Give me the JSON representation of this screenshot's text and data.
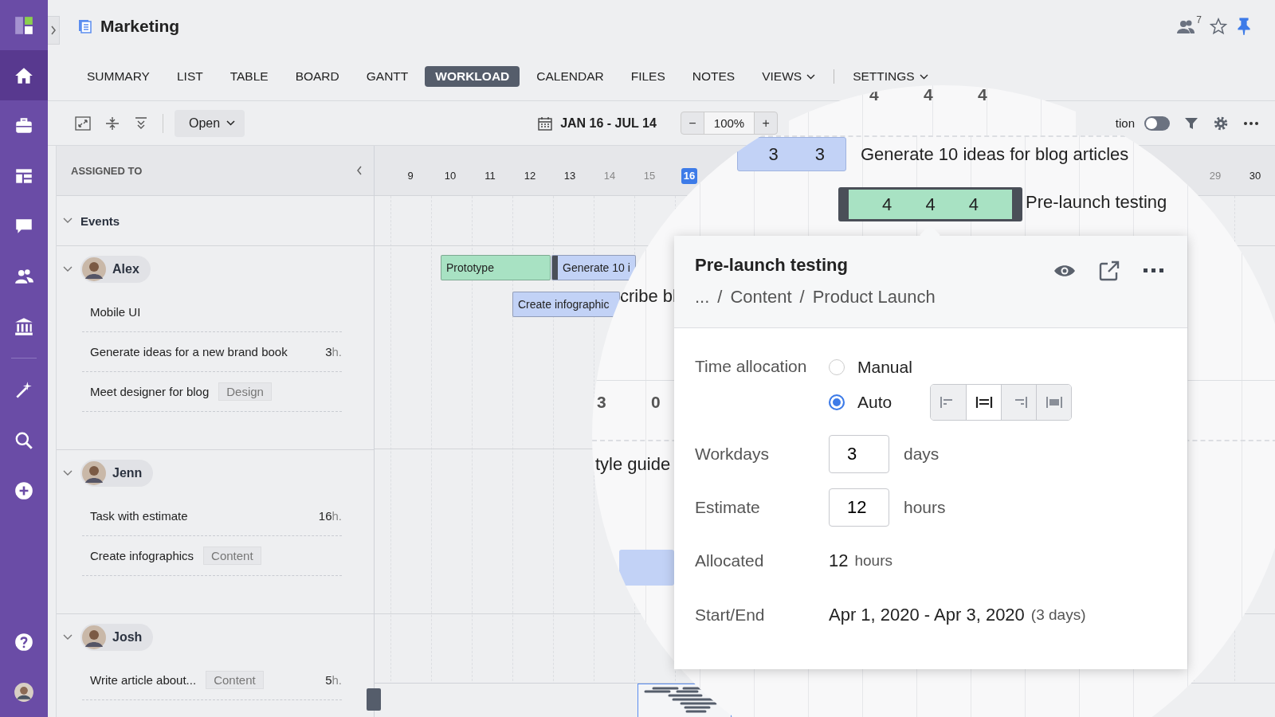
{
  "project": {
    "title": "Marketing"
  },
  "header_actions": {
    "member_count": "7",
    "pinned": true
  },
  "sidebar": {
    "items": [
      {
        "selected": false
      },
      {
        "selected": true
      },
      {
        "selected": false
      },
      {
        "selected": false
      },
      {
        "selected": false
      },
      {
        "selected": false
      },
      {
        "selected": false
      },
      {
        "selected": false
      },
      {
        "selected": false
      },
      {
        "selected": false
      },
      {
        "selected": false
      },
      {
        "selected": false
      }
    ]
  },
  "tabs": [
    {
      "label": "SUMMARY",
      "selected": false
    },
    {
      "label": "LIST",
      "selected": false
    },
    {
      "label": "TABLE",
      "selected": false
    },
    {
      "label": "BOARD",
      "selected": false
    },
    {
      "label": "GANTT",
      "selected": false
    },
    {
      "label": "WORKLOAD",
      "selected": true
    },
    {
      "label": "CALENDAR",
      "selected": false
    },
    {
      "label": "FILES",
      "selected": false
    },
    {
      "label": "NOTES",
      "selected": false
    }
  ],
  "menus": [
    {
      "label": "VIEWS"
    },
    {
      "label": "SETTINGS"
    }
  ],
  "toolbar": {
    "filter_button": "Open",
    "date_range": "JAN 16 - JUL 14",
    "zoom_out": "−",
    "zoom": "100%",
    "zoom_in": "+",
    "option_label": "tion",
    "option_on": false
  },
  "panel": {
    "heading": "ASSIGNED TO"
  },
  "groups": [
    {
      "name": "Events",
      "kind": "category",
      "expanded": true
    },
    {
      "name": "Alex",
      "kind": "person",
      "expanded": true,
      "tasks": [
        {
          "title": "Mobile UI"
        },
        {
          "title": "Generate ideas for a new brand book",
          "hours": "3",
          "unit": "h."
        },
        {
          "title": "Meet designer for blog",
          "tag": "Design"
        }
      ]
    },
    {
      "name": "Jenn",
      "kind": "person",
      "expanded": true,
      "tasks": [
        {
          "title": "Task with estimate",
          "hours": "16",
          "unit": "h."
        },
        {
          "title": "Create infographics",
          "tag": "Content"
        }
      ]
    },
    {
      "name": "Josh",
      "kind": "person",
      "expanded": true,
      "tasks": [
        {
          "title": "Write article about...",
          "tag": "Content",
          "hours": "5",
          "unit": "h."
        }
      ]
    }
  ],
  "timeline": {
    "days": [
      {
        "label": "9",
        "weekend": false,
        "selected": false
      },
      {
        "label": "10",
        "weekend": false,
        "selected": false
      },
      {
        "label": "11",
        "weekend": false,
        "selected": false
      },
      {
        "label": "12",
        "weekend": false,
        "selected": false
      },
      {
        "label": "13",
        "weekend": false,
        "selected": false
      },
      {
        "label": "14",
        "weekend": true,
        "selected": false
      },
      {
        "label": "15",
        "weekend": true,
        "selected": false
      },
      {
        "label": "16",
        "weekend": false,
        "selected": true
      },
      {
        "label": "29",
        "weekend": true,
        "selected": false
      },
      {
        "label": "30",
        "weekend": false,
        "selected": false
      }
    ]
  },
  "bars": [
    {
      "label": "Prototype",
      "color": "#a8e2c3"
    },
    {
      "label": "Generate 10 i",
      "color": "#c2d2f6"
    },
    {
      "label": "Create infographic",
      "color": "#c2d2f6"
    }
  ],
  "magnifier": {
    "top_counts": [
      "4",
      "4",
      "4"
    ],
    "blog_bar": {
      "counts": [
        "3",
        "3"
      ],
      "label": "Generate 10 ideas for blog articles"
    },
    "selected_bar": {
      "counts": [
        "4",
        "4",
        "4"
      ],
      "label": "Pre-launch testing"
    },
    "fragments": [
      "cribe bl",
      "tyle guide"
    ],
    "day_counts": [
      "3",
      "0"
    ]
  },
  "popover": {
    "title": "Pre-launch testing",
    "breadcrumb": [
      "...",
      "Content",
      "Product Launch"
    ],
    "breadcrumb_separators": [
      "/",
      "/"
    ],
    "time_allocation": {
      "label": "Time allocation",
      "options": [
        {
          "label": "Manual",
          "selected": false
        },
        {
          "label": "Auto",
          "selected": true
        }
      ],
      "align_modes": [
        {
          "selected": false
        },
        {
          "selected": true
        },
        {
          "selected": false
        },
        {
          "selected": false
        }
      ]
    },
    "fields": [
      {
        "kind": "input",
        "label": "Workdays",
        "value": "3",
        "unit": "days"
      },
      {
        "kind": "input",
        "label": "Estimate",
        "value": "12",
        "unit": "hours"
      },
      {
        "kind": "text",
        "label": "Allocated",
        "value": "12",
        "unit": "hours"
      },
      {
        "kind": "text",
        "label": "Start/End",
        "value": "Apr 1, 2020 - Apr 3, 2020",
        "unit": "(3 days)"
      }
    ]
  }
}
